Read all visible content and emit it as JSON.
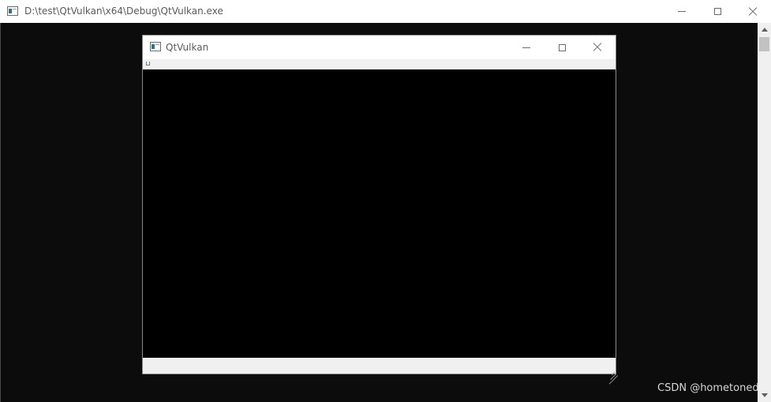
{
  "console": {
    "title": "D:\\test\\QtVulkan\\x64\\Debug\\QtVulkan.exe",
    "icon": "console-app-icon",
    "controls": {
      "minimize": "minimize-icon",
      "maximize": "maximize-icon",
      "close": "close-icon"
    },
    "background_color": "#0c0c0c"
  },
  "qt_window": {
    "title": "QtVulkan",
    "icon": "qt-app-icon",
    "controls": {
      "minimize": "minimize-icon",
      "maximize": "maximize-icon",
      "close": "close-icon"
    },
    "render_background": "#000000"
  },
  "watermark": {
    "text": "CSDN @hometoned"
  }
}
